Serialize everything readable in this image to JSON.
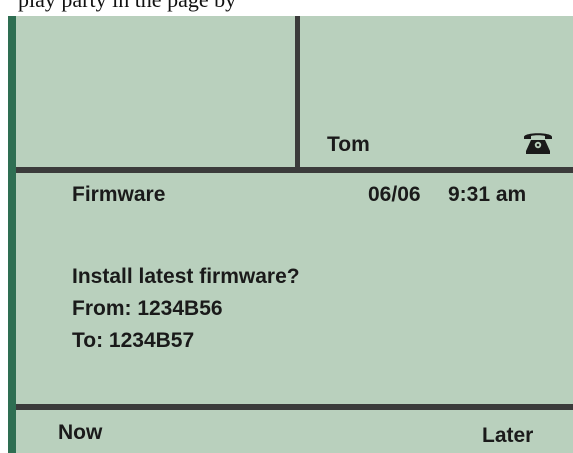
{
  "caption": "play party in the page by",
  "call_panel": {
    "line_name": "Tom",
    "line_icon": "telephone-icon"
  },
  "header": {
    "title": "Firmware",
    "date": "06/06",
    "time": "9:31 am"
  },
  "message": {
    "line1": "Install latest firmware?",
    "line2": "From: 1234B56",
    "line3": "To: 1234B57"
  },
  "softkeys": {
    "left_label": "Now",
    "right_label": "Later"
  },
  "colors": {
    "screen_background": "#b9d0bd",
    "bezel_accent": "#2e6e52",
    "divider": "#3b3b3b",
    "text": "#1a1a1a"
  }
}
